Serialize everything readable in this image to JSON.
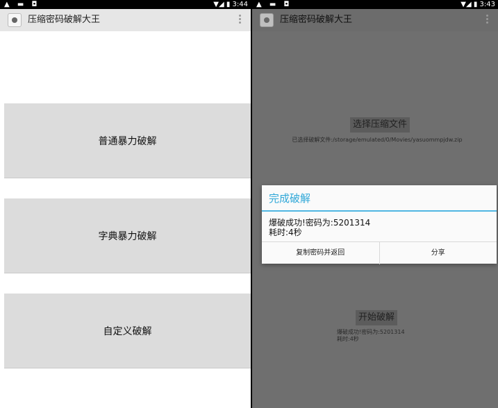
{
  "left": {
    "status": {
      "left_icons": "▲ ▬ ◘",
      "right_icons": "▼◢ ▮ 3:44"
    },
    "app_title": "压缩密码破解大王",
    "buttons": [
      "普通暴力破解",
      "字典暴力破解",
      "自定义破解"
    ]
  },
  "right": {
    "status": {
      "left_icons": "▲ ▬ ◘",
      "right_icons": "▼◢ ▮ 3:43"
    },
    "app_title": "压缩密码破解大王",
    "select_button": "选择压缩文件",
    "selected_file_text": "已选择破解文件:/storage/emulated/0/Movies/yasuommpjdw.zip",
    "start_button": "开始破解",
    "result_line1": "爆破成功!密码为:5201314",
    "result_line2": "耗时:4秒",
    "dialog": {
      "title": "完成破解",
      "message_line1": "爆破成功!密码为:5201314",
      "message_line2": "耗时:4秒",
      "copy_button": "复制密码并返回",
      "share_button": "分享"
    }
  }
}
